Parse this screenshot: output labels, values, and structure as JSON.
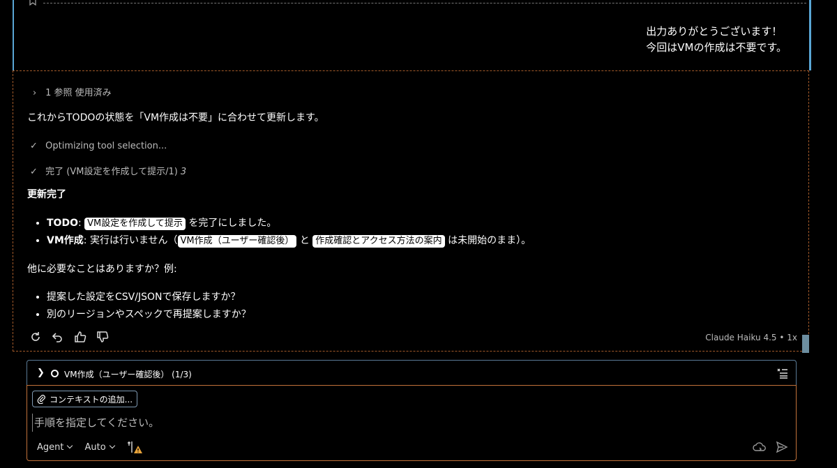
{
  "user_message": {
    "line1": "出力ありがとうございます！",
    "line2": "今回はVMの作成は不要です。"
  },
  "assistant": {
    "references": "1 参照 使用済み",
    "intro": "これからTODOの状態を「VM作成は不要」に合わせて更新します。",
    "step1": "Optimizing tool selection...",
    "step2_text": "完了 (VM設定を作成して提示/1) ",
    "step2_count": "3",
    "heading": "更新完了",
    "bullets": {
      "b1_label": "TODO",
      "b1_colon": ": ",
      "b1_code": "VM設定を作成して提示",
      "b1_rest": " を完了にしました。",
      "b2_label": "VM作成",
      "b2_colon": ": 実行は行いません（",
      "b2_code1": "VM作成（ユーザー確認後）",
      "b2_mid": " と ",
      "b2_code2": "作成確認とアクセス方法の案内",
      "b2_rest": " は未開始のまま）。"
    },
    "question": "他に必要なことはありますか？例:",
    "options": [
      "提案した設定をCSV/JSONで保存しますか？",
      "別のリージョンやスペックで再提案しますか？"
    ],
    "model": "Claude Haiku 4.5 • 1x"
  },
  "todo": {
    "label": "VM作成（ユーザー確認後） (1/3)"
  },
  "input": {
    "context_button": "コンテキストの追加...",
    "placeholder": "手順を指定してください。",
    "mode": "Agent",
    "model": "Auto"
  },
  "colors": {
    "accent_blue": "#5aa7d6",
    "accent_orange": "#c2723a"
  },
  "icons": [
    "bookmark-icon",
    "chevron-right-icon",
    "check-icon",
    "retry-icon",
    "undo-icon",
    "thumbs-up-icon",
    "thumbs-down-icon",
    "todo-list-icon",
    "paperclip-icon",
    "tools-icon",
    "cloud-icon",
    "send-icon"
  ]
}
